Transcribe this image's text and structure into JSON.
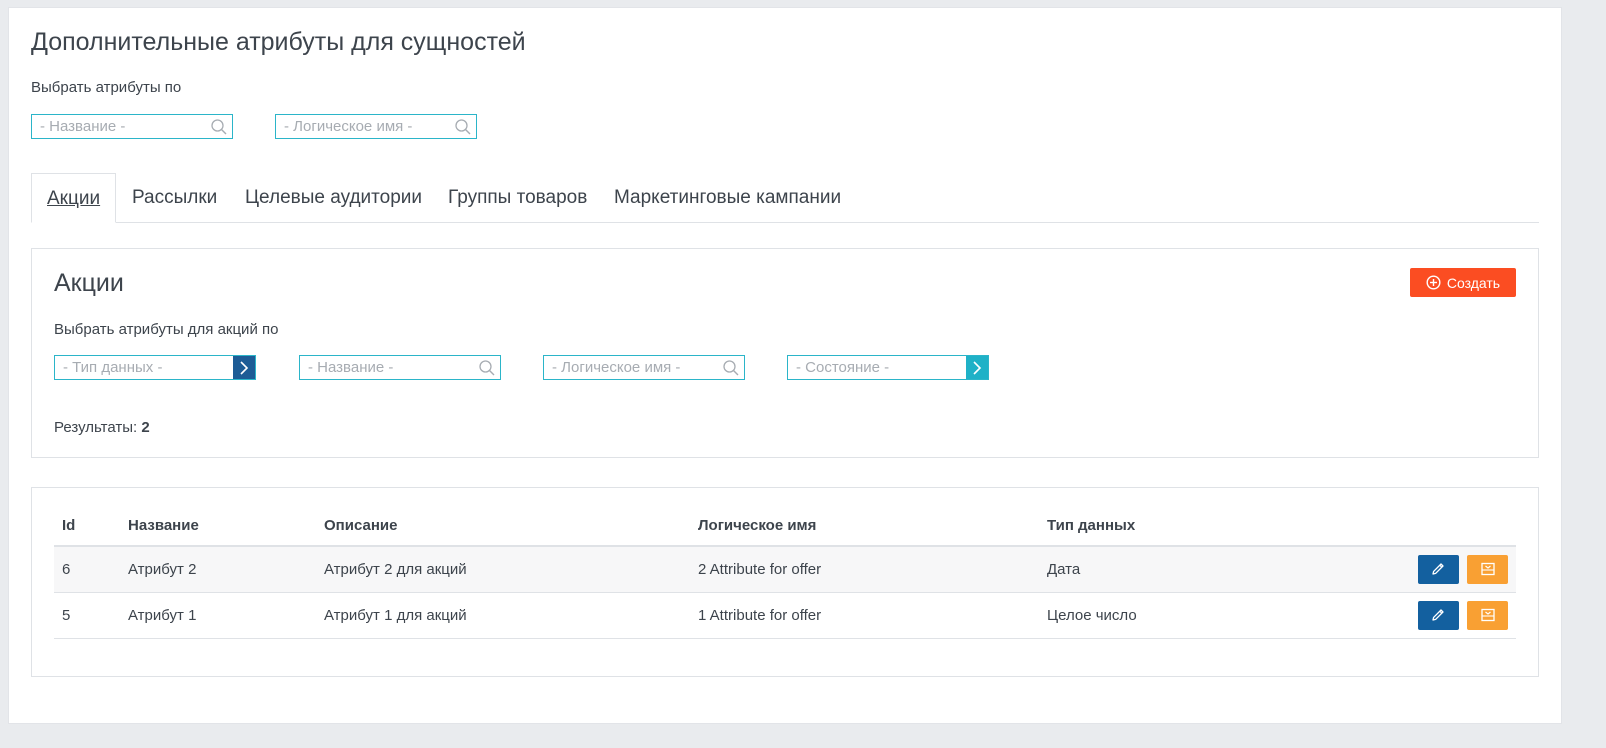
{
  "page": {
    "title": "Дополнительные атрибуты для сущностей",
    "filter_label": "Выбрать атрибуты по",
    "filters": {
      "name_placeholder": "- Название -",
      "logical_name_placeholder": "- Логическое имя -"
    }
  },
  "tabs": [
    {
      "label": "Акции",
      "active": true
    },
    {
      "label": "Рассылки",
      "active": false
    },
    {
      "label": "Целевые аудитории",
      "active": false
    },
    {
      "label": "Группы товаров",
      "active": false
    },
    {
      "label": "Маркетинговые кампании",
      "active": false
    }
  ],
  "offers_panel": {
    "title": "Акции",
    "create_label": "Создать",
    "filter_label": "Выбрать атрибуты для акций по",
    "filters": {
      "data_type_placeholder": "- Тип данных -",
      "name_placeholder": "- Название -",
      "logical_name_placeholder": "- Логическое имя -",
      "state_placeholder": "- Состояние -"
    },
    "results_label": "Результаты:",
    "results_count": "2"
  },
  "table": {
    "columns": [
      "Id",
      "Название",
      "Описание",
      "Логическое имя",
      "Тип данных"
    ],
    "rows": [
      {
        "id": "6",
        "name": "Атрибут 2",
        "description": "Атрибут 2 для акций",
        "logical_name": "2 Attribute for offer",
        "data_type": "Дата"
      },
      {
        "id": "5",
        "name": "Атрибут 1",
        "description": "Атрибут 1 для акций",
        "logical_name": "1 Attribute for offer",
        "data_type": "Целое число"
      }
    ]
  },
  "colors": {
    "accent_border": "#2bb5c9",
    "create_button": "#fb4d22",
    "edit_button": "#13609f",
    "archive_button": "#f9a033",
    "arrow_dark": "#1d5c96",
    "arrow_teal": "#1fb1c7"
  },
  "icons": {
    "search": "magnifier-icon",
    "arrow": "chevron-right-icon",
    "create": "plus-circle-icon",
    "edit": "pencil-icon",
    "archive": "archive-icon"
  }
}
